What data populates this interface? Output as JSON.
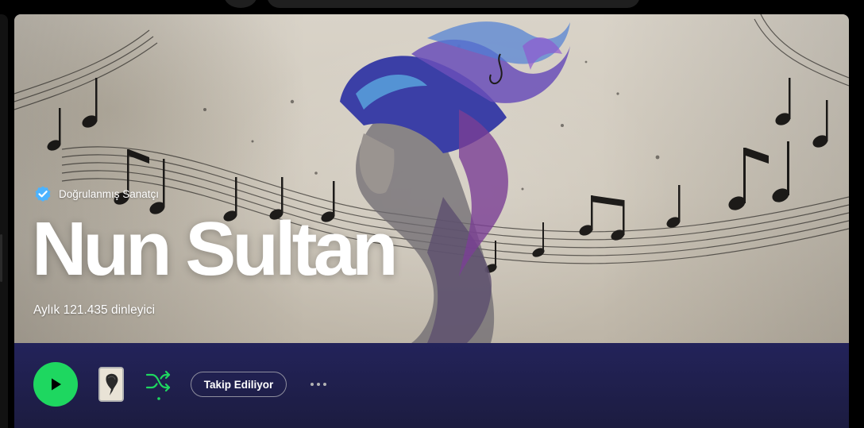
{
  "artist": {
    "verified_label": "Doğrulanmış Sanatçı",
    "name": "Nun Sultan",
    "monthly_listeners": "Aylık 121.435 dinleyici"
  },
  "actions": {
    "play_icon": "play-icon",
    "shuffle_icon": "shuffle-icon",
    "follow_label": "Takip Ediliyor",
    "more_icon": "more-dots-icon"
  },
  "colors": {
    "accent_green": "#1ed760",
    "verified_blue": "#4cb3ff",
    "action_bar": "#23235a"
  }
}
